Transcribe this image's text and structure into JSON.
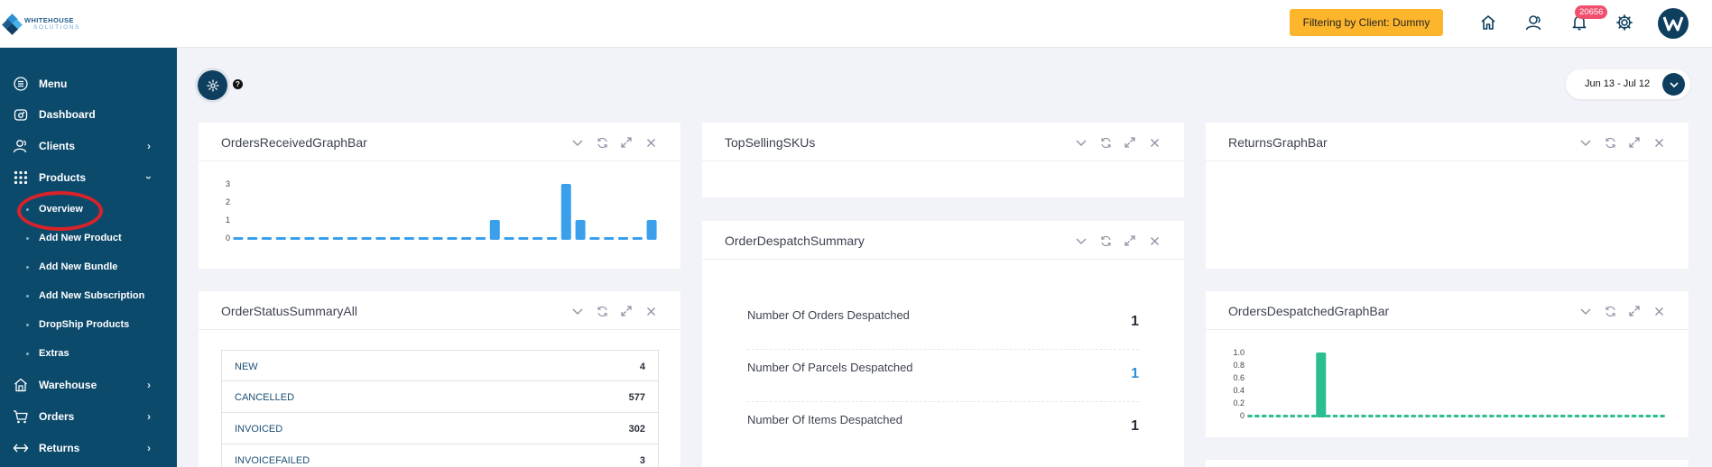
{
  "header": {
    "logo_line1": "WHITEHOUSE",
    "logo_line2": "SOLUTIONS",
    "filter_label": "Filtering by Client: Dummy",
    "notification_count": "20656",
    "icons": [
      "home-icon",
      "users-icon",
      "bell-icon",
      "gear-icon",
      "avatar-logo-icon"
    ]
  },
  "sidebar": {
    "items": [
      {
        "label": "Menu",
        "icon": "menu-icon"
      },
      {
        "label": "Dashboard",
        "icon": "dashboard-icon"
      },
      {
        "label": "Clients",
        "icon": "clients-icon"
      },
      {
        "label": "Products",
        "icon": "grid-icon"
      },
      {
        "label": "Warehouse",
        "icon": "warehouse-icon"
      },
      {
        "label": "Orders",
        "icon": "cart-icon"
      },
      {
        "label": "Returns",
        "icon": "returns-icon"
      }
    ],
    "product_subitems": [
      "Overview",
      "Add New Product",
      "Add New Bundle",
      "Add New Subscription",
      "DropShip Products",
      "Extras"
    ],
    "selected_subitem": "Overview"
  },
  "toolbar": {
    "date_range": "Jun 13 - Jul 12"
  },
  "cards": {
    "orders_received": {
      "title": "OrdersReceivedGraphBar"
    },
    "top_selling": {
      "title": "TopSellingSKUs"
    },
    "returns": {
      "title": "ReturnsGraphBar"
    },
    "despatch_summary": {
      "title": "OrderDespatchSummary",
      "stats": [
        {
          "label": "Number Of Orders Despatched",
          "value": "1"
        },
        {
          "label": "Number Of Parcels Despatched",
          "value": "1"
        },
        {
          "label": "Number Of Items Despatched",
          "value": "1"
        }
      ]
    },
    "status_summary": {
      "title": "OrderStatusSummaryAll",
      "rows": [
        {
          "name": "NEW",
          "value": "4"
        },
        {
          "name": "CANCELLED",
          "value": "577"
        },
        {
          "name": "INVOICED",
          "value": "302"
        },
        {
          "name": "INVOICEFAILED",
          "value": "3"
        }
      ]
    },
    "orders_despatched": {
      "title": "OrdersDespatchedGraphBar"
    }
  },
  "colors": {
    "sidebar_bg": "#0c4a6c",
    "filter_bg": "#fdb62c",
    "received_bar": "#3aa0ec",
    "despatched_bar": "#2dbd93",
    "badge_bg": "#f0506e"
  },
  "chart_data": [
    {
      "type": "bar",
      "title": "OrdersReceivedGraphBar",
      "ylim": [
        0,
        3
      ],
      "yticks": [
        "0",
        "1",
        "2",
        "3"
      ],
      "values": [
        0,
        0,
        0,
        0,
        0,
        0,
        0,
        0,
        0,
        0,
        0,
        0,
        0,
        0,
        0,
        0,
        0,
        0,
        1,
        0,
        0,
        0,
        0,
        3,
        1,
        0,
        0,
        0,
        0,
        1
      ],
      "color": "#3aa0ec"
    },
    {
      "type": "bar",
      "title": "OrdersDespatchedGraphBar",
      "ylim": [
        0,
        1
      ],
      "yticks": [
        "0",
        "0.2",
        "0.4",
        "0.6",
        "0.8",
        "1.0"
      ],
      "values": [
        0,
        0,
        0,
        0,
        0,
        0,
        0,
        0,
        0,
        0,
        1,
        0,
        0,
        0,
        0,
        0,
        0,
        0,
        0,
        0,
        0,
        0,
        0,
        0,
        0,
        0,
        0,
        0,
        0,
        0,
        0,
        0,
        0,
        0,
        0,
        0,
        0,
        0,
        0,
        0,
        0,
        0,
        0,
        0,
        0,
        0,
        0,
        0,
        0,
        0,
        0,
        0,
        0,
        0,
        0,
        0,
        0,
        0,
        0
      ],
      "color": "#2dbd93"
    }
  ]
}
